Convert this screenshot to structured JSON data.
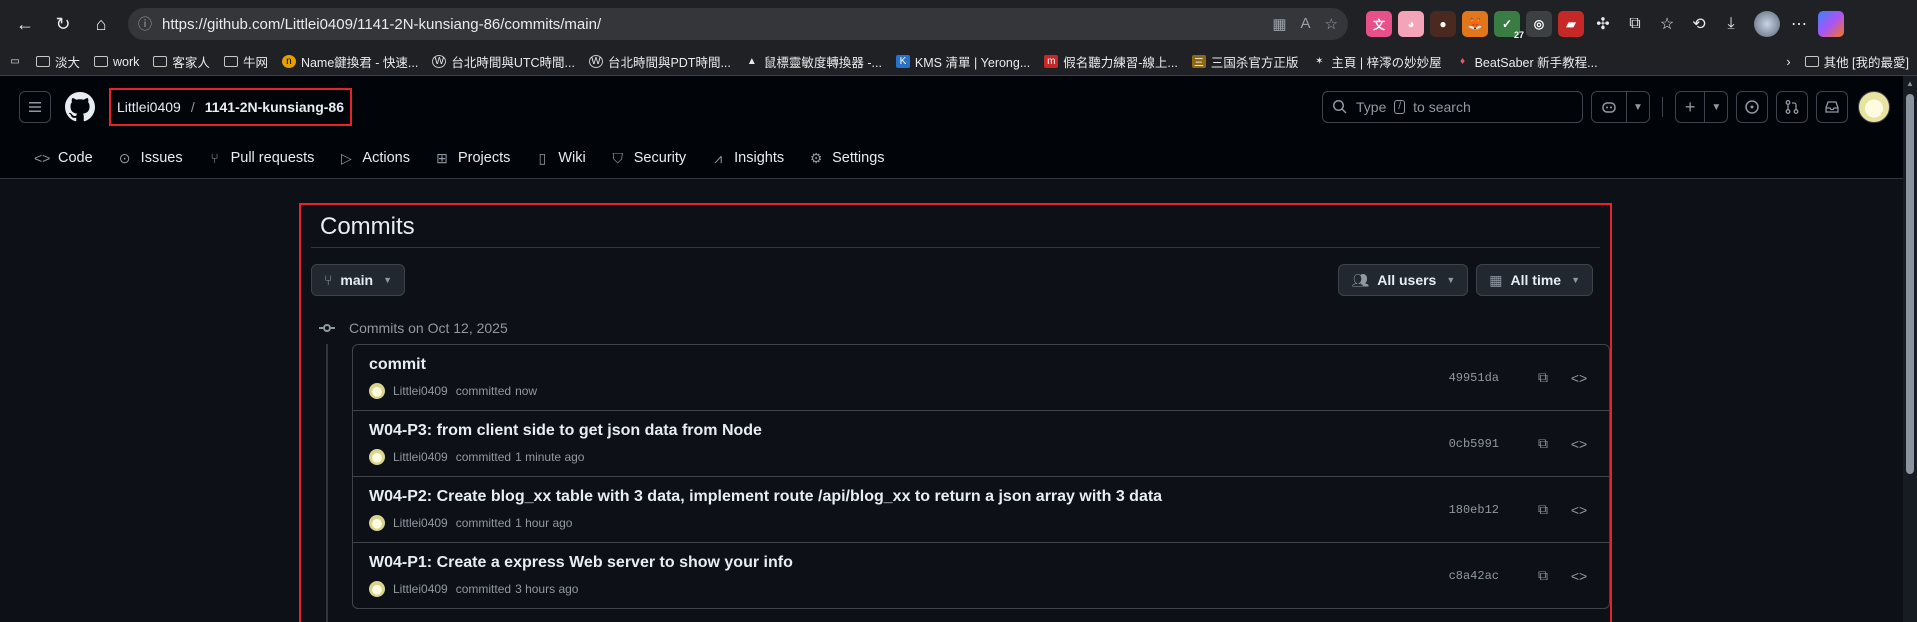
{
  "browser": {
    "url": "https://github.com/Littlei0409/1141-2N-kunsiang-86/commits/main/",
    "extension_badge": "27"
  },
  "bookmarks": [
    {
      "label": "淡大",
      "icon": "folder-icon"
    },
    {
      "label": "work",
      "icon": "folder-icon"
    },
    {
      "label": "客家人",
      "icon": "folder-icon"
    },
    {
      "label": "牛网",
      "icon": "folder-icon"
    },
    {
      "label": "Name鍵換君 - 快速...",
      "icon": "name-icon"
    },
    {
      "label": "台北時間與UTC時間...",
      "icon": "wordpress-icon"
    },
    {
      "label": "台北時間與PDT時間...",
      "icon": "wordpress-icon"
    },
    {
      "label": "鼠標靈敏度轉換器 -...",
      "icon": "mouse-icon"
    },
    {
      "label": "KMS 清單 | Yerong...",
      "icon": "kms-icon"
    },
    {
      "label": "假名聽力練習-線上...",
      "icon": "m-icon"
    },
    {
      "label": "三国杀官方正版",
      "icon": "sgs-icon"
    },
    {
      "label": "主頁 | 梓澪の妙妙屋",
      "icon": "ninja-icon"
    },
    {
      "label": "BeatSaber 新手教程...",
      "icon": "beatsaber-icon"
    }
  ],
  "bookmarks_other": "其他 [我的最愛]",
  "repo": {
    "owner": "Littlei0409",
    "separator": "/",
    "name": "1141-2N-kunsiang-86"
  },
  "search": {
    "prefix": "Type",
    "key": "/",
    "suffix": "to search"
  },
  "nav": [
    {
      "label": "Code",
      "icon": "code-icon"
    },
    {
      "label": "Issues",
      "icon": "issue-icon"
    },
    {
      "label": "Pull requests",
      "icon": "pull-request-icon"
    },
    {
      "label": "Actions",
      "icon": "play-icon"
    },
    {
      "label": "Projects",
      "icon": "table-icon"
    },
    {
      "label": "Wiki",
      "icon": "book-icon"
    },
    {
      "label": "Security",
      "icon": "shield-icon"
    },
    {
      "label": "Insights",
      "icon": "graph-icon"
    },
    {
      "label": "Settings",
      "icon": "gear-icon"
    }
  ],
  "page": {
    "title": "Commits",
    "branch": "main",
    "users_filter": "All users",
    "time_filter": "All time",
    "day_label": "Commits on Oct 12, 2025"
  },
  "commits": [
    {
      "title": "commit",
      "author": "Littlei0409",
      "verb": "committed",
      "time": "now",
      "sha": "49951da"
    },
    {
      "title": "W04-P3: from client side to get json data from Node",
      "author": "Littlei0409",
      "verb": "committed",
      "time": "1 minute ago",
      "sha": "0cb5991"
    },
    {
      "title": "W04-P2: Create blog_xx table with 3 data, implement route /api/blog_xx to return a json array with 3 data",
      "author": "Littlei0409",
      "verb": "committed",
      "time": "1 hour ago",
      "sha": "180eb12"
    },
    {
      "title": "W04-P1: Create a express Web server to show your info",
      "author": "Littlei0409",
      "verb": "committed",
      "time": "3 hours ago",
      "sha": "c8a42ac"
    }
  ],
  "colors": {
    "background": "#0d1117",
    "header": "#010409",
    "border": "#3d444d",
    "highlight_box": "#e5232a",
    "text": "#e6edf3",
    "muted": "#9198a1"
  }
}
